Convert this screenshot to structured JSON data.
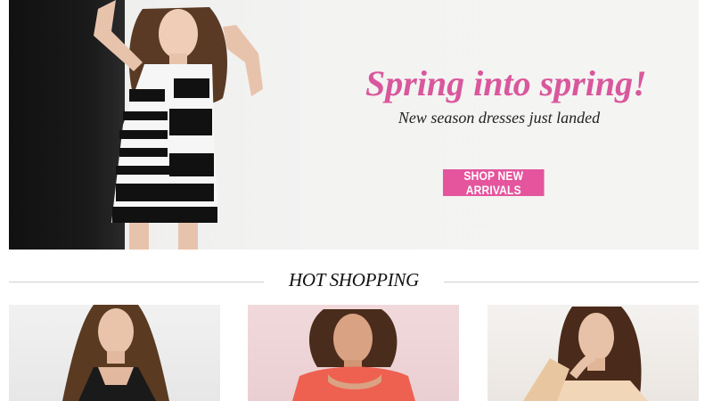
{
  "hero": {
    "headline": "Spring into spring!",
    "subheadline": "New season dresses just landed",
    "cta_label": "SHOP NEW ARRIVALS"
  },
  "section": {
    "title": "HOT SHOPPING"
  },
  "colors": {
    "accent": "#e4559e",
    "headline": "#d9579c",
    "text": "#111111",
    "divider": "#cfcfcf"
  }
}
